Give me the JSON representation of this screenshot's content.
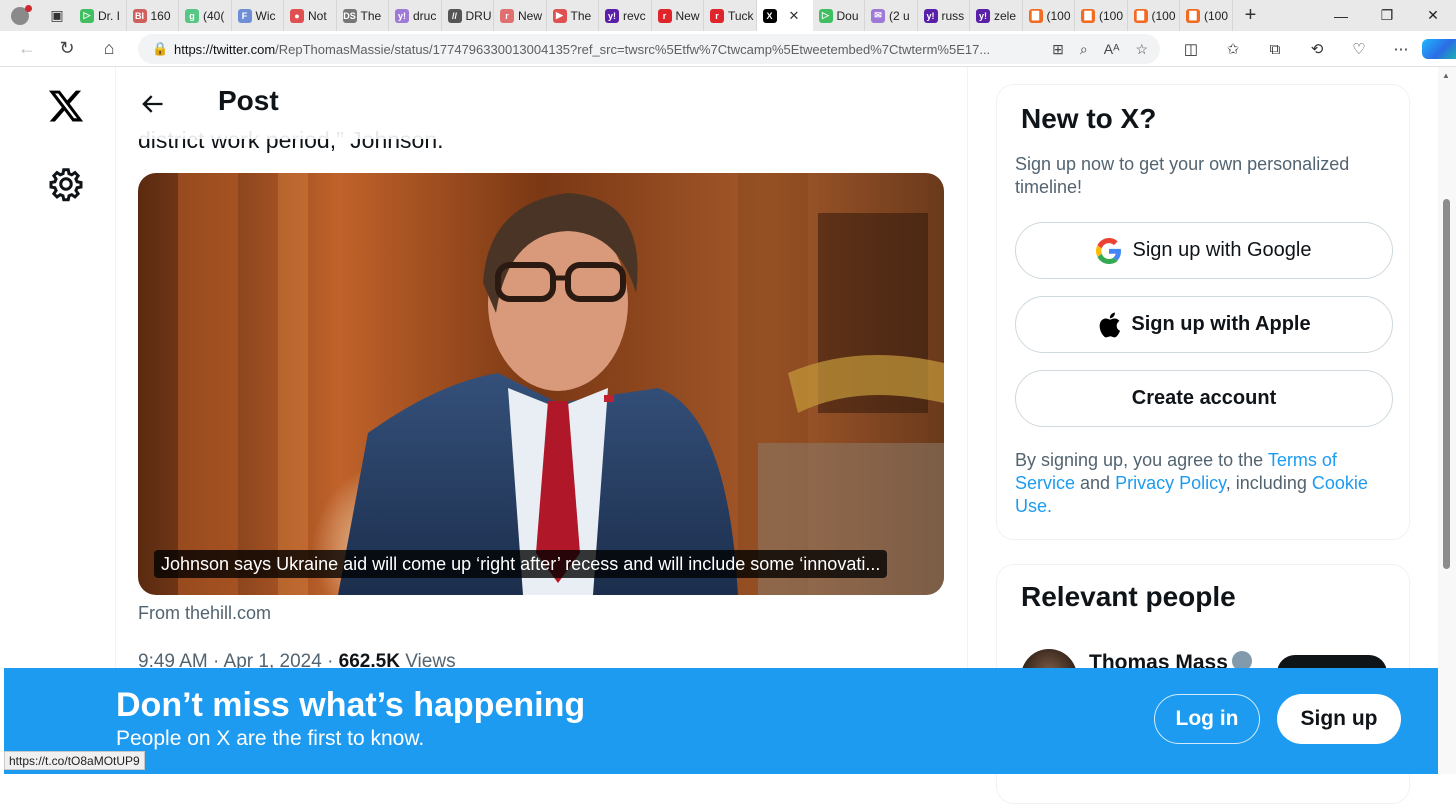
{
  "browser": {
    "tabs": [
      {
        "title": "Dr. I",
        "color": "#3fbf5f",
        "glyph": "▷"
      },
      {
        "title": "160",
        "color": "#d06060",
        "glyph": "BI"
      },
      {
        "title": "(40(",
        "color": "#57c785",
        "glyph": "g"
      },
      {
        "title": "Wic",
        "color": "#6e8ed6",
        "glyph": "F"
      },
      {
        "title": "Not",
        "color": "#e05050",
        "glyph": "●"
      },
      {
        "title": "The",
        "color": "#777777",
        "glyph": "DS"
      },
      {
        "title": "druc",
        "color": "#9e7ad6",
        "glyph": "y!"
      },
      {
        "title": "DRU",
        "color": "#555555",
        "glyph": "//"
      },
      {
        "title": "New",
        "color": "#e07070",
        "glyph": "r"
      },
      {
        "title": "The",
        "color": "#e05050",
        "glyph": "▶"
      },
      {
        "title": "revc",
        "color": "#5a1fa8",
        "glyph": "y!"
      },
      {
        "title": "New",
        "color": "#e0242b",
        "glyph": "r"
      },
      {
        "title": "Tuck",
        "color": "#e0242b",
        "glyph": "r"
      }
    ],
    "active_tab": {
      "glyph": "X",
      "close": "✕"
    },
    "tabs_after": [
      {
        "title": "Dou",
        "color": "#3fbf5f",
        "glyph": "▷"
      },
      {
        "title": "(2 u",
        "color": "#9e7ad6",
        "glyph": "✉"
      },
      {
        "title": "russ",
        "color": "#5a1fa8",
        "glyph": "y!"
      },
      {
        "title": "zele",
        "color": "#5a1fa8",
        "glyph": "y!"
      },
      {
        "title": "(100",
        "color": "#f26b21",
        "glyph": "▇"
      },
      {
        "title": "(100",
        "color": "#f26b21",
        "glyph": "▇"
      },
      {
        "title": "(100",
        "color": "#f26b21",
        "glyph": "▇"
      },
      {
        "title": "(100",
        "color": "#f26b21",
        "glyph": "▇"
      }
    ],
    "url_host": "https://twitter.com",
    "url_path": "/RepThomasMassie/status/1774796330013004135?ref_src=twsrc%5Etfw%7Ctwcamp%5Etweetembed%7Ctwterm%5E17...",
    "status_link": "https://t.co/tO8aMOtUP9"
  },
  "post": {
    "header_title": "Post",
    "cut_text": "district work period,” Johnson.",
    "card_caption": "Johnson says Ukraine aid will come up ‘right after’ recess and will include some ‘innovati...",
    "source": "From thehill.com",
    "time": "9:49 AM · Apr 1, 2024 · ",
    "views_count": "662.5K",
    "views_label": " Views"
  },
  "signup": {
    "title": "New to X?",
    "subtitle": "Sign up now to get your own personalized timeline!",
    "google": "Sign up with Google",
    "apple": "Sign up with Apple",
    "create": "Create account",
    "terms_pre": "By signing up, you agree to the ",
    "terms_link": "Terms of Service",
    "terms_and": " and ",
    "privacy_link": "Privacy Policy",
    "terms_inc": ", including ",
    "cookie_link": "Cookie Use."
  },
  "relevant": {
    "title": "Relevant people",
    "name": "Thomas Mass"
  },
  "banner": {
    "title": "Don’t miss what’s happening",
    "subtitle": "People on X are the first to know.",
    "login": "Log in",
    "signup": "Sign up"
  },
  "colors": {
    "brand": "#1d9bf0",
    "text": "#0f1419",
    "secondary": "#536471"
  }
}
